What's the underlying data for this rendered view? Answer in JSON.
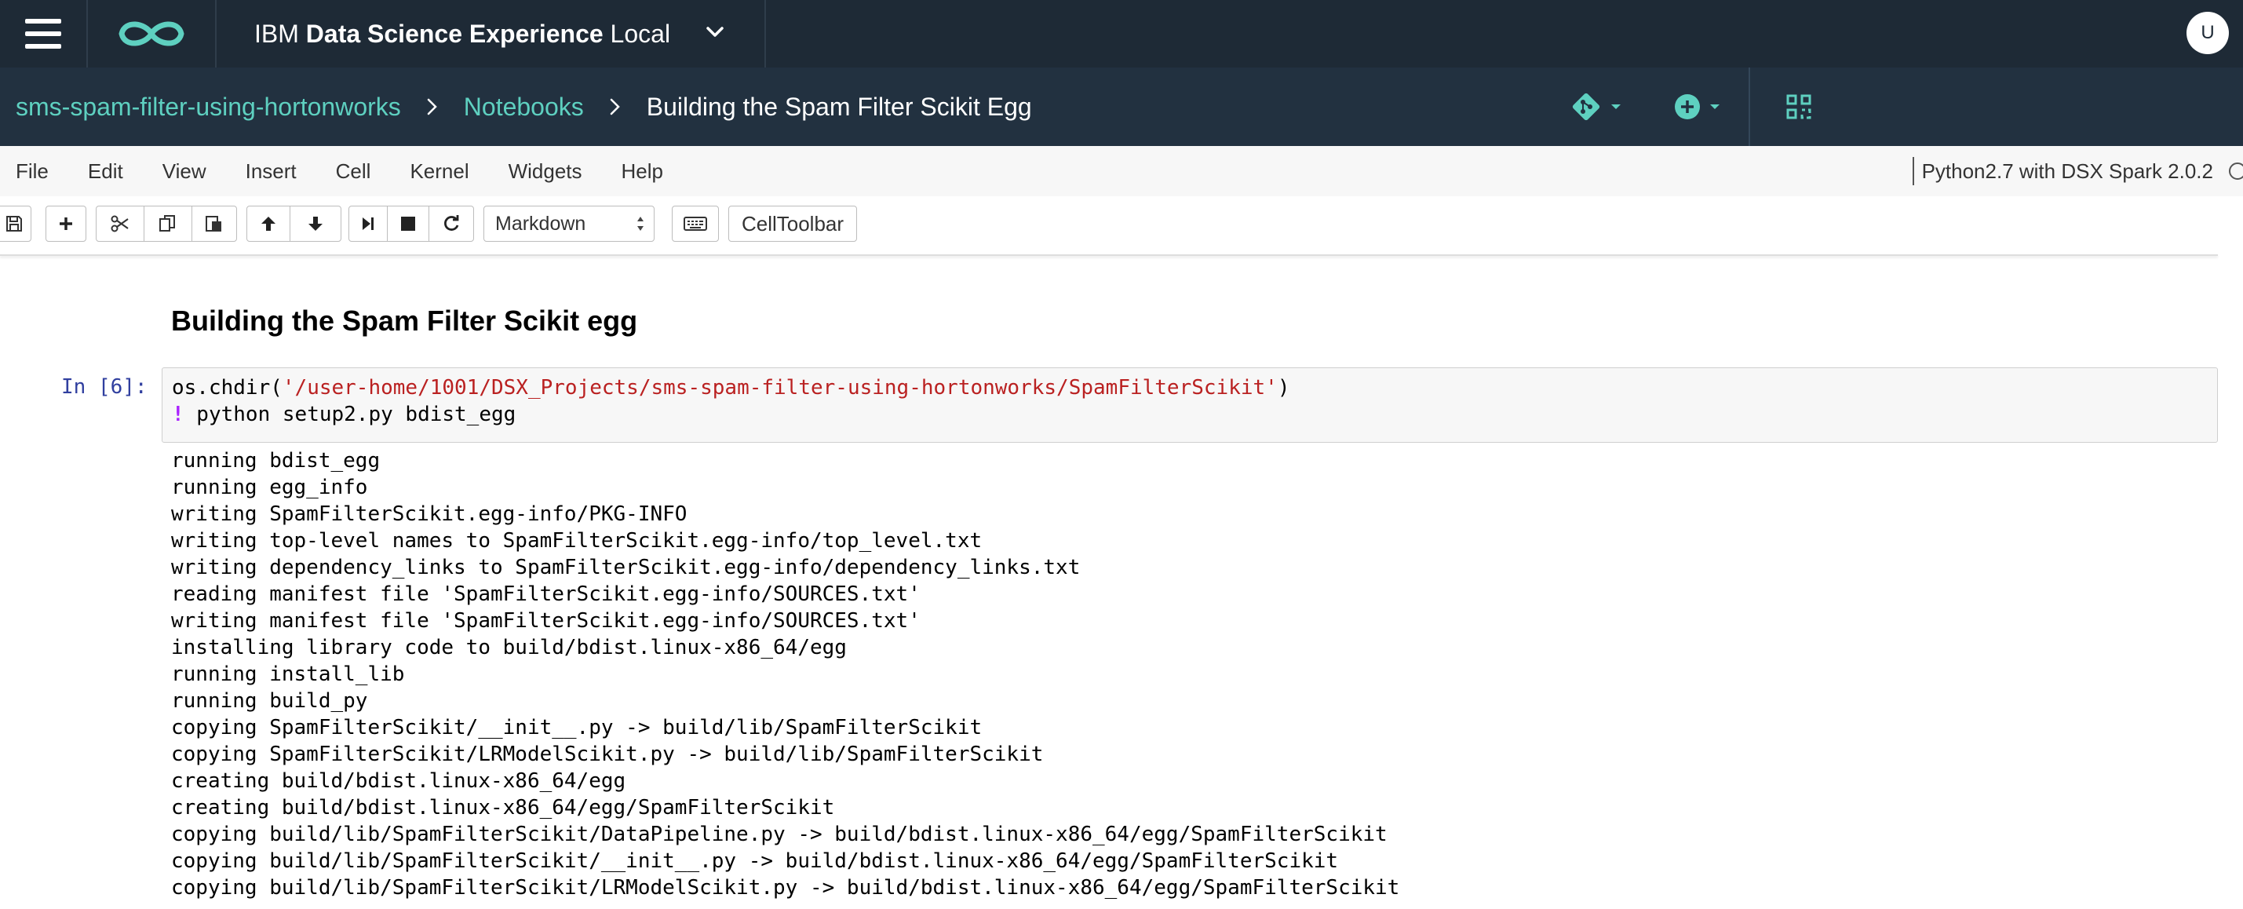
{
  "header": {
    "menu_icon": "hamburger-menu-icon",
    "logo_icon": "infinity-logo-icon",
    "brand_prefix": "IBM",
    "brand_name": "Data Science Experience",
    "brand_suffix": "Local",
    "brand_dropdown_icon": "chevron-down-icon",
    "user_initial": "U"
  },
  "breadcrumb": {
    "project": "sms-spam-filter-using-hortonworks",
    "section": "Notebooks",
    "current": "Building the Spam Filter Scikit Egg",
    "separator_icon": "chevron-right-icon"
  },
  "breadcrumb_tools": {
    "git_icon": "git-icon",
    "add_icon": "add-circle-icon",
    "assets_icon": "assets-panel-icon"
  },
  "menubar": {
    "items": [
      "File",
      "Edit",
      "View",
      "Insert",
      "Cell",
      "Kernel",
      "Widgets",
      "Help"
    ],
    "kernel_name": "Python2.7 with DSX Spark 2.0.2",
    "kernel_status_icon": "kernel-idle-circle-icon"
  },
  "toolbar": {
    "buttons": [
      "save-icon",
      "plus-icon",
      "cut-icon",
      "copy-icon",
      "paste-icon",
      "arrow-up-icon",
      "arrow-down-icon",
      "run-step-icon",
      "stop-icon",
      "restart-icon",
      "keyboard-icon"
    ],
    "cell_type": "Markdown",
    "cell_toolbar_label": "CellToolbar"
  },
  "notebook": {
    "markdown_heading": "Building the Spam Filter Scikit egg",
    "cell": {
      "prompt": "In [6]:",
      "code_line1_prefix": "os.chdir(",
      "code_line1_string": "'/user-home/1001/DSX_Projects/sms-spam-filter-using-hortonworks/SpamFilterScikit'",
      "code_line1_suffix": ")",
      "code_line2_bang": "!",
      "code_line2_rest": " python setup2.py bdist_egg",
      "output": [
        "running bdist_egg",
        "running egg_info",
        "writing SpamFilterScikit.egg-info/PKG-INFO",
        "writing top-level names to SpamFilterScikit.egg-info/top_level.txt",
        "writing dependency_links to SpamFilterScikit.egg-info/dependency_links.txt",
        "reading manifest file 'SpamFilterScikit.egg-info/SOURCES.txt'",
        "writing manifest file 'SpamFilterScikit.egg-info/SOURCES.txt'",
        "installing library code to build/bdist.linux-x86_64/egg",
        "running install_lib",
        "running build_py",
        "copying SpamFilterScikit/__init__.py -> build/lib/SpamFilterScikit",
        "copying SpamFilterScikit/LRModelScikit.py -> build/lib/SpamFilterScikit",
        "creating build/bdist.linux-x86_64/egg",
        "creating build/bdist.linux-x86_64/egg/SpamFilterScikit",
        "copying build/lib/SpamFilterScikit/DataPipeline.py -> build/bdist.linux-x86_64/egg/SpamFilterScikit",
        "copying build/lib/SpamFilterScikit/__init__.py -> build/bdist.linux-x86_64/egg/SpamFilterScikit",
        "copying build/lib/SpamFilterScikit/LRModelScikit.py -> build/bdist.linux-x86_64/egg/SpamFilterScikit"
      ]
    }
  },
  "colors": {
    "header_bg": "#1e2a36",
    "breadcrumb_bg": "#223140",
    "accent_teal": "#5ed0c0",
    "prompt_blue": "#303f9f",
    "string_red": "#ba2121",
    "bang_purple": "#aa22ff"
  }
}
